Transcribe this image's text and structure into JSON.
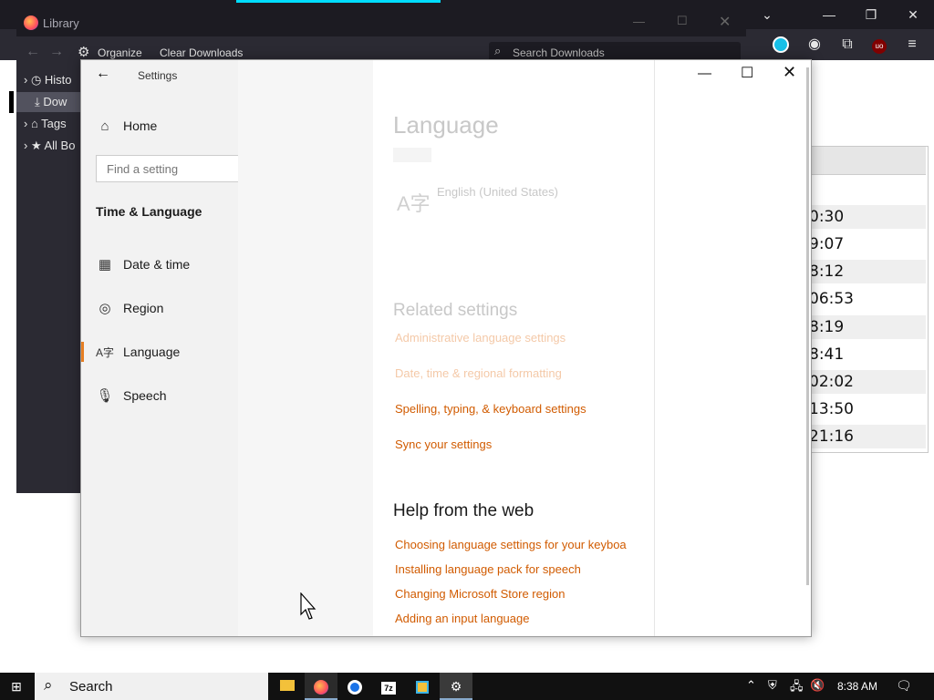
{
  "library": {
    "title": "Library",
    "toolbar": {
      "organize": "Organize",
      "clear_downloads": "Clear Downloads",
      "search_placeholder": "Search Downloads"
    },
    "tree": [
      "Histo",
      "Dow",
      "Tags",
      "All Bo"
    ]
  },
  "firefox": {
    "times": [
      "0:30",
      "9:07",
      "8:12",
      "06:53",
      "8:19",
      "8:41",
      "02:02",
      "13:50",
      "21:16"
    ]
  },
  "settings": {
    "window_title": "Settings",
    "nav": {
      "home": "Home",
      "search_placeholder": "Find a setting",
      "section": "Time & Language",
      "items": [
        "Date & time",
        "Region",
        "Language",
        "Speech"
      ]
    },
    "content": {
      "page_title": "Language",
      "display_language": "English (United States)",
      "related_heading": "Related settings",
      "related_links": [
        "Administrative language settings",
        "Date, time & regional formatting",
        "Spelling, typing, & keyboard settings",
        "Sync your settings"
      ],
      "help_heading": "Help from the web",
      "help_links": [
        "Choosing language settings for your keyboa",
        "Installing language pack for speech",
        "Changing Microsoft Store region",
        "Adding an input language"
      ]
    }
  },
  "taskbar": {
    "search_label": "Search",
    "clock": "8:38 AM"
  },
  "colors": {
    "accent": "#d15b00",
    "nav_indicator": "#e67e22"
  }
}
